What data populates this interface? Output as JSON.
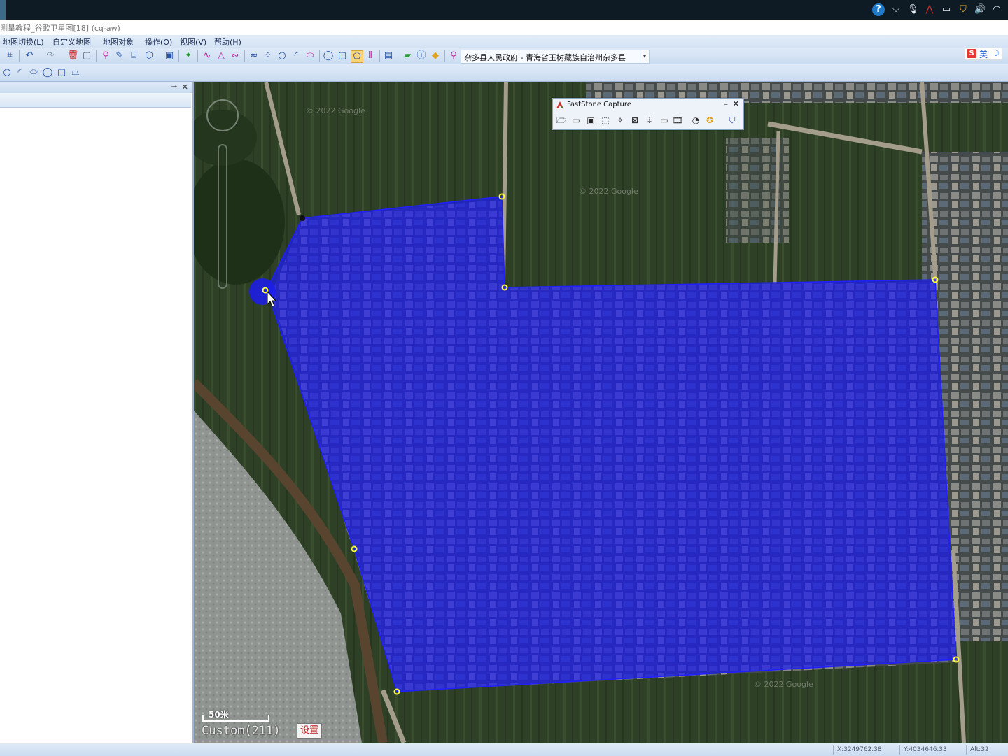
{
  "os_tray": {
    "icons": [
      "help-icon",
      "chevron-up-icon",
      "microphone-icon",
      "app-icon",
      "battery-icon",
      "shield-icon",
      "volume-icon",
      "wifi-icon"
    ],
    "help_glyph": "?"
  },
  "window": {
    "title": "测量教程_谷歌卫星图[18] (cq-aw)"
  },
  "menu": {
    "items": [
      {
        "label": "地图切换(L)"
      },
      {
        "label": "自定义地图"
      },
      {
        "label": "地图对象"
      },
      {
        "label": "操作(O)"
      },
      {
        "label": "视图(V)"
      },
      {
        "label": "帮助(H)"
      }
    ]
  },
  "toolbar": {
    "location": "杂多县人民政府 - 青海省玉树藏族自治州杂多县",
    "ime": {
      "logo": "S",
      "lang": "英",
      "moon": "☽"
    }
  },
  "capture_tool": {
    "title": "FastStone Capture",
    "min_glyph": "–",
    "close_glyph": "✕"
  },
  "map": {
    "scale_label": "50米",
    "zoom_label": "Custom(211)",
    "settings_label": "设置",
    "polygon_color": "#1c1cf0",
    "vertex_color": "#ffff3a",
    "watermark": "© 2022 Google"
  },
  "status": {
    "x": "X:3249762.38",
    "y": "Y:4034646.33",
    "alt": "Alt:32"
  }
}
